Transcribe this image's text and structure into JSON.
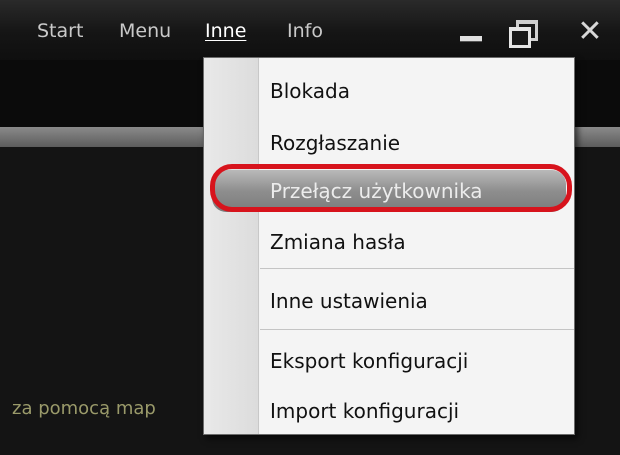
{
  "menubar": {
    "items": [
      "Start",
      "Menu",
      "Inne",
      "Info"
    ],
    "active": "Inne"
  },
  "window_controls": {
    "minimize_icon": "minimize-icon",
    "restore_icon": "restore-icon",
    "close_icon": "close-icon"
  },
  "background": {
    "hint_text": "za pomocą map"
  },
  "dropdown": {
    "items": [
      {
        "label": "Blokada"
      },
      {
        "label": "Rozgłaszanie"
      },
      {
        "label": "Przełącz użytkownika",
        "highlighted": true
      },
      {
        "label": "Zmiana hasła"
      },
      {
        "label": "Inne ustawienia"
      },
      {
        "label": "Eksport konfiguracji"
      },
      {
        "label": "Import konfiguracji"
      }
    ]
  },
  "colors": {
    "highlight_ring": "#d7131c",
    "menu_bg": "#f4f4f4",
    "titlebar_bg": "#1e1e1e"
  }
}
